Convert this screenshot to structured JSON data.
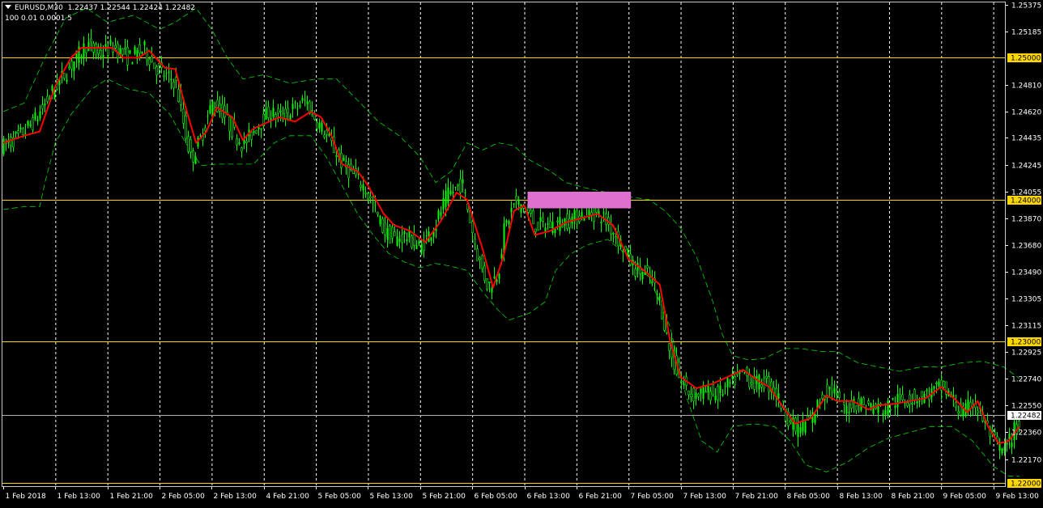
{
  "header": {
    "symbol_timeframe": "EURUSD,M30",
    "ohlc": "1.22437 1.22544 1.22424 1.22482",
    "indicator_params": "100 0.01 0.0001 5"
  },
  "colors": {
    "background": "#000000",
    "bull_candle": "#00ff00",
    "moving_average": "#ff0000",
    "bands": "#00ff00",
    "level_line": "#ffd700",
    "level_label_bg": "#ffd700",
    "current_price_line": "#b0b0b0",
    "zone_rect": "#e070d0",
    "grid": "#ffffff",
    "axis_text": "#ffffff"
  },
  "chart_data": {
    "type": "candlestick",
    "symbol": "EURUSD",
    "timeframe": "M30",
    "price_axis_ticks": [
      "1.25375",
      "1.25185",
      "1.24810",
      "1.24620",
      "1.24435",
      "1.24245",
      "1.24055",
      "1.23870",
      "1.23680",
      "1.23490",
      "1.23305",
      "1.23115",
      "1.22925",
      "1.22740",
      "1.22550",
      "1.22360",
      "1.22170"
    ],
    "time_axis_ticks": [
      "1 Feb 2018",
      "1 Feb 13:00",
      "1 Feb 21:00",
      "2 Feb 05:00",
      "2 Feb 13:00",
      "4 Feb 21:00",
      "5 Feb 05:00",
      "5 Feb 13:00",
      "5 Feb 21:00",
      "6 Feb 05:00",
      "6 Feb 13:00",
      "6 Feb 21:00",
      "7 Feb 05:00",
      "7 Feb 13:00",
      "7 Feb 21:00",
      "8 Feb 05:00",
      "8 Feb 13:00",
      "8 Feb 21:00",
      "9 Feb 05:00",
      "9 Feb 13:00"
    ],
    "ylim": [
      1.2198,
      1.2539
    ],
    "horizontal_levels": [
      {
        "price": 1.25,
        "label": "1.25000"
      },
      {
        "price": 1.24,
        "label": "1.24000"
      },
      {
        "price": 1.23,
        "label": "1.23000"
      },
      {
        "price": 1.22,
        "label": "1.22000"
      }
    ],
    "current_price": {
      "price": 1.22482,
      "label": "1.22482"
    },
    "zone": {
      "from_time": "6 Feb 13:00",
      "to_time": "7 Feb 05:00",
      "price_low": 1.2395,
      "price_high": 1.2405
    },
    "close_path": [
      [
        0,
        1.2438
      ],
      [
        0.3,
        1.2445
      ],
      [
        0.6,
        1.2456
      ],
      [
        1.0,
        1.248
      ],
      [
        1.3,
        1.2495
      ],
      [
        1.6,
        1.251
      ],
      [
        1.8,
        1.2502
      ],
      [
        2.1,
        1.2508
      ],
      [
        2.4,
        1.25
      ],
      [
        2.7,
        1.2506
      ],
      [
        2.9,
        1.2494
      ],
      [
        3.1,
        1.2487
      ],
      [
        3.3,
        1.2483
      ],
      [
        3.5,
        1.2445
      ],
      [
        3.6,
        1.2428
      ],
      [
        3.8,
        1.2445
      ],
      [
        4.0,
        1.2468
      ],
      [
        4.2,
        1.2462
      ],
      [
        4.4,
        1.2448
      ],
      [
        4.6,
        1.2438
      ],
      [
        4.9,
        1.2454
      ],
      [
        5.1,
        1.2462
      ],
      [
        5.3,
        1.2458
      ],
      [
        5.6,
        1.2465
      ],
      [
        5.8,
        1.247
      ],
      [
        6.0,
        1.2456
      ],
      [
        6.2,
        1.2445
      ],
      [
        6.5,
        1.2425
      ],
      [
        6.7,
        1.2418
      ],
      [
        6.9,
        1.241
      ],
      [
        7.1,
        1.2395
      ],
      [
        7.3,
        1.2378
      ],
      [
        7.5,
        1.2372
      ],
      [
        7.7,
        1.2375
      ],
      [
        8.0,
        1.2366
      ],
      [
        8.3,
        1.2384
      ],
      [
        8.5,
        1.2402
      ],
      [
        8.8,
        1.2412
      ],
      [
        9.1,
        1.236
      ],
      [
        9.3,
        1.2338
      ],
      [
        9.5,
        1.235
      ],
      [
        9.6,
        1.2378
      ],
      [
        9.8,
        1.2398
      ],
      [
        10.0,
        1.2395
      ],
      [
        10.2,
        1.2382
      ],
      [
        10.5,
        1.2382
      ],
      [
        10.8,
        1.2385
      ],
      [
        11.0,
        1.2388
      ],
      [
        11.2,
        1.2392
      ],
      [
        11.5,
        1.2388
      ],
      [
        11.8,
        1.2372
      ],
      [
        12.1,
        1.2352
      ],
      [
        12.4,
        1.2346
      ],
      [
        12.6,
        1.2328
      ],
      [
        12.8,
        1.229
      ],
      [
        13.0,
        1.2272
      ],
      [
        13.2,
        1.2262
      ],
      [
        13.5,
        1.2265
      ],
      [
        13.7,
        1.2262
      ],
      [
        14.0,
        1.2272
      ],
      [
        14.2,
        1.2278
      ],
      [
        14.4,
        1.227
      ],
      [
        14.6,
        1.2272
      ],
      [
        14.8,
        1.2265
      ],
      [
        15.0,
        1.225
      ],
      [
        15.2,
        1.2238
      ],
      [
        15.5,
        1.2245
      ],
      [
        15.7,
        1.2262
      ],
      [
        15.9,
        1.2268
      ],
      [
        16.1,
        1.225
      ],
      [
        16.3,
        1.2258
      ],
      [
        16.6,
        1.2255
      ],
      [
        16.9,
        1.2252
      ],
      [
        17.1,
        1.2258
      ],
      [
        17.4,
        1.226
      ],
      [
        17.7,
        1.2262
      ],
      [
        18.0,
        1.2268
      ],
      [
        18.2,
        1.226
      ],
      [
        18.4,
        1.2248
      ],
      [
        18.6,
        1.2258
      ],
      [
        18.8,
        1.2245
      ],
      [
        19.0,
        1.223
      ],
      [
        19.2,
        1.2222
      ],
      [
        19.4,
        1.2238
      ],
      [
        19.5,
        1.2242
      ]
    ],
    "moving_average_path": [
      [
        0,
        1.244
      ],
      [
        0.4,
        1.2445
      ],
      [
        0.7,
        1.2448
      ],
      [
        1.0,
        1.248
      ],
      [
        1.3,
        1.25
      ],
      [
        1.5,
        1.2507
      ],
      [
        1.8,
        1.2507
      ],
      [
        2.1,
        1.2507
      ],
      [
        2.3,
        1.25
      ],
      [
        2.6,
        1.25
      ],
      [
        2.8,
        1.2505
      ],
      [
        3.1,
        1.2493
      ],
      [
        3.3,
        1.2492
      ],
      [
        3.5,
        1.2465
      ],
      [
        3.7,
        1.244
      ],
      [
        3.9,
        1.2448
      ],
      [
        4.1,
        1.2465
      ],
      [
        4.4,
        1.2458
      ],
      [
        4.6,
        1.2442
      ],
      [
        4.8,
        1.245
      ],
      [
        5.1,
        1.2455
      ],
      [
        5.3,
        1.2458
      ],
      [
        5.6,
        1.2455
      ],
      [
        5.9,
        1.2462
      ],
      [
        6.1,
        1.2458
      ],
      [
        6.3,
        1.2445
      ],
      [
        6.5,
        1.2425
      ],
      [
        6.8,
        1.242
      ],
      [
        7.0,
        1.241
      ],
      [
        7.3,
        1.239
      ],
      [
        7.5,
        1.2382
      ],
      [
        7.8,
        1.2378
      ],
      [
        8.1,
        1.237
      ],
      [
        8.4,
        1.2385
      ],
      [
        8.7,
        1.2405
      ],
      [
        8.9,
        1.24
      ],
      [
        9.2,
        1.2365
      ],
      [
        9.4,
        1.2338
      ],
      [
        9.6,
        1.236
      ],
      [
        9.8,
        1.2392
      ],
      [
        10.0,
        1.2396
      ],
      [
        10.2,
        1.2375
      ],
      [
        10.5,
        1.2378
      ],
      [
        10.8,
        1.2384
      ],
      [
        11.1,
        1.2387
      ],
      [
        11.4,
        1.239
      ],
      [
        11.7,
        1.2382
      ],
      [
        12.0,
        1.2358
      ],
      [
        12.3,
        1.235
      ],
      [
        12.6,
        1.234
      ],
      [
        12.8,
        1.23
      ],
      [
        13.0,
        1.2275
      ],
      [
        13.3,
        1.2267
      ],
      [
        13.6,
        1.227
      ],
      [
        13.9,
        1.2275
      ],
      [
        14.2,
        1.228
      ],
      [
        14.5,
        1.2272
      ],
      [
        14.7,
        1.2268
      ],
      [
        15.0,
        1.2252
      ],
      [
        15.2,
        1.2242
      ],
      [
        15.5,
        1.2246
      ],
      [
        15.8,
        1.2262
      ],
      [
        16.0,
        1.2258
      ],
      [
        16.3,
        1.2258
      ],
      [
        16.6,
        1.2252
      ],
      [
        16.8,
        1.2255
      ],
      [
        17.1,
        1.2256
      ],
      [
        17.4,
        1.2258
      ],
      [
        17.7,
        1.226
      ],
      [
        18.0,
        1.2268
      ],
      [
        18.3,
        1.2258
      ],
      [
        18.5,
        1.225
      ],
      [
        18.7,
        1.2258
      ],
      [
        18.9,
        1.224
      ],
      [
        19.1,
        1.2228
      ],
      [
        19.3,
        1.223
      ],
      [
        19.5,
        1.224
      ]
    ],
    "upper_band_path": [
      [
        0,
        1.2462
      ],
      [
        0.4,
        1.2468
      ],
      [
        0.8,
        1.25
      ],
      [
        1.2,
        1.2528
      ],
      [
        1.6,
        1.2535
      ],
      [
        2.0,
        1.2525
      ],
      [
        2.5,
        1.253
      ],
      [
        3.0,
        1.252
      ],
      [
        3.3,
        1.2525
      ],
      [
        3.7,
        1.2535
      ],
      [
        4.0,
        1.252
      ],
      [
        4.3,
        1.25
      ],
      [
        4.6,
        1.2485
      ],
      [
        5.0,
        1.2488
      ],
      [
        5.5,
        1.2482
      ],
      [
        6.0,
        1.2485
      ],
      [
        6.4,
        1.2485
      ],
      [
        6.8,
        1.247
      ],
      [
        7.2,
        1.2455
      ],
      [
        7.6,
        1.2445
      ],
      [
        8.0,
        1.243
      ],
      [
        8.3,
        1.2412
      ],
      [
        8.6,
        1.242
      ],
      [
        8.9,
        1.244
      ],
      [
        9.2,
        1.2435
      ],
      [
        9.5,
        1.244
      ],
      [
        9.8,
        1.2438
      ],
      [
        10.1,
        1.2428
      ],
      [
        10.5,
        1.242
      ],
      [
        10.8,
        1.2412
      ],
      [
        11.2,
        1.2408
      ],
      [
        11.6,
        1.2405
      ],
      [
        12.0,
        1.2402
      ],
      [
        12.4,
        1.24
      ],
      [
        12.7,
        1.2392
      ],
      [
        13.0,
        1.238
      ],
      [
        13.3,
        1.236
      ],
      [
        13.6,
        1.233
      ],
      [
        13.8,
        1.2305
      ],
      [
        14.0,
        1.229
      ],
      [
        14.3,
        1.2287
      ],
      [
        14.6,
        1.2288
      ],
      [
        15.0,
        1.2295
      ],
      [
        15.3,
        1.2295
      ],
      [
        15.7,
        1.2293
      ],
      [
        16.0,
        1.2293
      ],
      [
        16.4,
        1.2285
      ],
      [
        16.8,
        1.2282
      ],
      [
        17.2,
        1.2279
      ],
      [
        17.6,
        1.2282
      ],
      [
        18.0,
        1.2282
      ],
      [
        18.4,
        1.2285
      ],
      [
        18.8,
        1.2286
      ],
      [
        19.2,
        1.2282
      ],
      [
        19.5,
        1.2274
      ]
    ],
    "lower_band_path": [
      [
        0,
        1.2393
      ],
      [
        0.4,
        1.2395
      ],
      [
        0.7,
        1.2395
      ],
      [
        0.8,
        1.2412
      ],
      [
        1.0,
        1.244
      ],
      [
        1.3,
        1.246
      ],
      [
        1.7,
        1.2478
      ],
      [
        2.0,
        1.2485
      ],
      [
        2.4,
        1.2478
      ],
      [
        2.8,
        1.2475
      ],
      [
        3.2,
        1.246
      ],
      [
        3.5,
        1.244
      ],
      [
        3.8,
        1.2424
      ],
      [
        4.1,
        1.2425
      ],
      [
        4.5,
        1.2425
      ],
      [
        4.8,
        1.2425
      ],
      [
        5.2,
        1.244
      ],
      [
        5.5,
        1.2445
      ],
      [
        5.9,
        1.2445
      ],
      [
        6.2,
        1.243
      ],
      [
        6.5,
        1.241
      ],
      [
        6.8,
        1.239
      ],
      [
        7.1,
        1.2375
      ],
      [
        7.4,
        1.2362
      ],
      [
        7.7,
        1.2356
      ],
      [
        8.0,
        1.2352
      ],
      [
        8.3,
        1.2355
      ],
      [
        8.6,
        1.2353
      ],
      [
        8.9,
        1.235
      ],
      [
        9.2,
        1.2335
      ],
      [
        9.5,
        1.2322
      ],
      [
        9.7,
        1.2315
      ],
      [
        10.1,
        1.232
      ],
      [
        10.4,
        1.2328
      ],
      [
        10.6,
        1.235
      ],
      [
        10.9,
        1.2362
      ],
      [
        11.2,
        1.2368
      ],
      [
        11.6,
        1.2372
      ],
      [
        12.0,
        1.236
      ],
      [
        12.4,
        1.2345
      ],
      [
        12.8,
        1.231
      ],
      [
        13.1,
        1.2262
      ],
      [
        13.4,
        1.223
      ],
      [
        13.7,
        1.2222
      ],
      [
        14.0,
        1.224
      ],
      [
        14.4,
        1.2242
      ],
      [
        14.8,
        1.224
      ],
      [
        15.1,
        1.223
      ],
      [
        15.4,
        1.2213
      ],
      [
        15.8,
        1.2208
      ],
      [
        16.2,
        1.2215
      ],
      [
        16.6,
        1.2225
      ],
      [
        17.0,
        1.2232
      ],
      [
        17.4,
        1.2236
      ],
      [
        17.8,
        1.224
      ],
      [
        18.2,
        1.224
      ],
      [
        18.6,
        1.223
      ],
      [
        19.0,
        1.2212
      ],
      [
        19.3,
        1.2205
      ],
      [
        19.5,
        1.2205
      ]
    ]
  }
}
